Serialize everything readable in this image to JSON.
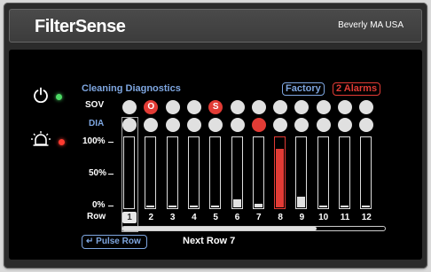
{
  "header": {
    "brand": "FilterSense",
    "location": "Beverly MA USA"
  },
  "screen": {
    "title": "Cleaning Diagnostics",
    "factory_label": "Factory",
    "alarms_label": "2 Alarms",
    "labels": {
      "sov": "SOV",
      "dia": "DIA",
      "pct100": "100%",
      "pct50": "50%",
      "pct0": "0%",
      "row": "Row"
    },
    "columns": [
      {
        "num": "1",
        "sov": "",
        "sov_red": false,
        "dia_red": false,
        "fill": 0.0,
        "selected": true,
        "active": false
      },
      {
        "num": "2",
        "sov": "O",
        "sov_red": true,
        "dia_red": false,
        "fill": 0.02,
        "selected": false,
        "active": false
      },
      {
        "num": "3",
        "sov": "",
        "sov_red": false,
        "dia_red": false,
        "fill": 0.03,
        "selected": false,
        "active": false
      },
      {
        "num": "4",
        "sov": "",
        "sov_red": false,
        "dia_red": false,
        "fill": 0.03,
        "selected": false,
        "active": false
      },
      {
        "num": "5",
        "sov": "S",
        "sov_red": true,
        "dia_red": false,
        "fill": 0.03,
        "selected": false,
        "active": false
      },
      {
        "num": "6",
        "sov": "",
        "sov_red": false,
        "dia_red": false,
        "fill": 0.12,
        "selected": false,
        "active": false
      },
      {
        "num": "7",
        "sov": "",
        "sov_red": false,
        "dia_red": true,
        "fill": 0.05,
        "selected": false,
        "active": false
      },
      {
        "num": "8",
        "sov": "",
        "sov_red": false,
        "dia_red": false,
        "fill": 0.85,
        "selected": false,
        "active": true
      },
      {
        "num": "9",
        "sov": "",
        "sov_red": false,
        "dia_red": false,
        "fill": 0.15,
        "selected": false,
        "active": false
      },
      {
        "num": "10",
        "sov": "",
        "sov_red": false,
        "dia_red": false,
        "fill": 0.03,
        "selected": false,
        "active": false
      },
      {
        "num": "11",
        "sov": "",
        "sov_red": false,
        "dia_red": false,
        "fill": 0.03,
        "selected": false,
        "active": false
      },
      {
        "num": "12",
        "sov": "",
        "sov_red": false,
        "dia_red": false,
        "fill": 0.03,
        "selected": false,
        "active": false
      }
    ],
    "progress": 0.74,
    "pulse_button": "Pulse Row",
    "pulse_icon": "return-arrow-icon",
    "next_row": "Next Row 7"
  },
  "indicators": {
    "power": {
      "icon": "power-icon",
      "led_color": "#4cd964"
    },
    "alarm": {
      "icon": "alarm-bell-icon",
      "led_color": "#ff3b30"
    }
  },
  "colors": {
    "accent_blue": "#7ea6e0",
    "alarm_red": "#e23b35"
  }
}
